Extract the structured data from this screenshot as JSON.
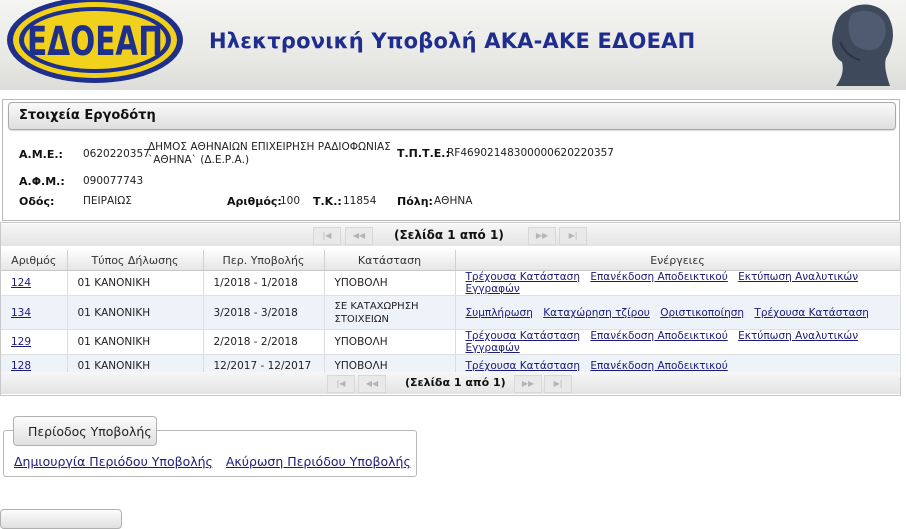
{
  "header": {
    "logo_text": "ΕΔΟΕΑΠ",
    "title": "Ηλεκτρονική Υποβολή ΑΚΑ-ΑΚΕ ΕΔΟΕΑΠ"
  },
  "employer": {
    "section_title": "Στοιχεία Εργοδότη",
    "ame_label": "Α.Μ.Ε.:",
    "ame_value": "0620220357",
    "name_line1": "ΔΗΜΟΣ ΑΘΗΝΑΙΩΝ ΕΠΙΧΕΙΡΗΣΗ ΡΑΔΙΟΦΩΝΙΑΣ",
    "name_line2": "`ΑΘΗΝΑ` (Δ.Ε.Ρ.Α.)",
    "tpte_label": "Τ.Π.Τ.Ε.:",
    "tpte_value": "RF46902148300000620220357",
    "afm_label": "Α.Φ.Μ.:",
    "afm_value": "090077743",
    "street_label": "Οδός:",
    "street_value": "ΠΕΙΡΑΙΩΣ",
    "number_label": "Αριθμός:",
    "number_value": "100",
    "zip_label": "Τ.Κ.:",
    "zip_value": "11854",
    "city_label": "Πόλη:",
    "city_value": "ΑΘΗΝΑ"
  },
  "grid": {
    "pager_text": "(Σελίδα 1 από 1)",
    "columns": [
      "Αριθμός",
      "Τύπος Δήλωσης",
      "Περ. Υποβολής",
      "Κατάσταση",
      "Ενέργειες"
    ],
    "rows": [
      {
        "id": "124",
        "type": "01 ΚΑΝΟΝΙΚΗ",
        "period": "1/2018 - 1/2018",
        "status": "ΥΠΟΒΟΛΗ",
        "actions": [
          "Τρέχουσα Κατάσταση",
          "Επανέκδοση Αποδεικτικού",
          "Εκτύπωση Αναλυτικών Εγγραφών"
        ]
      },
      {
        "id": "134",
        "type": "01 ΚΑΝΟΝΙΚΗ",
        "period": "3/2018 - 3/2018",
        "status": "ΣΕ ΚΑΤΑΧΩΡΗΣΗ ΣΤΟΙΧΕΙΩΝ",
        "actions": [
          "Συμπλήρωση",
          "Καταχώρηση τζίρου",
          "Οριστικοποίηση",
          "Τρέχουσα Κατάσταση"
        ]
      },
      {
        "id": "129",
        "type": "01 ΚΑΝΟΝΙΚΗ",
        "period": "2/2018 - 2/2018",
        "status": "ΥΠΟΒΟΛΗ",
        "actions": [
          "Τρέχουσα Κατάσταση",
          "Επανέκδοση Αποδεικτικού",
          "Εκτύπωση Αναλυτικών Εγγραφών"
        ]
      },
      {
        "id": "128",
        "type": "01 ΚΑΝΟΝΙΚΗ",
        "period": "12/2017 - 12/2017",
        "status": "ΥΠΟΒΟΛΗ",
        "actions": [
          "Τρέχουσα Κατάσταση",
          "Επανέκδοση Αποδεικτικού"
        ]
      }
    ]
  },
  "period": {
    "tab_label": "Περίοδος Υποβολής",
    "create_link": "Δημιουργία Περιόδου Υποβολής",
    "cancel_link": "Ακύρωση Περιόδου Υποβολής"
  },
  "colors": {
    "title_blue": "#1f2d8f",
    "link": "#1b1b7a",
    "logo_yellow": "#f2d11c",
    "logo_navy": "#1e2f8c"
  }
}
